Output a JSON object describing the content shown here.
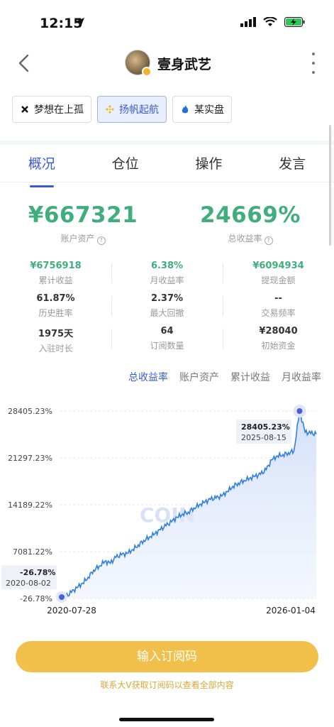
{
  "status": {
    "time": "12:15"
  },
  "nav": {
    "title": "壹身武艺"
  },
  "chips": [
    {
      "label": "梦想在上孤",
      "icon": "cross-logo-icon",
      "active": false
    },
    {
      "label": "扬帆起航",
      "icon": "binance-logo-icon",
      "active": true
    },
    {
      "label": "某实盘",
      "icon": "flame-logo-icon",
      "active": false
    }
  ],
  "tabs": [
    "概况",
    "仓位",
    "操作",
    "发言"
  ],
  "summary": {
    "assets_value": "¥667321",
    "assets_label": "账户资产",
    "return_value": "24669%",
    "return_label": "总收益率"
  },
  "grid": [
    [
      {
        "value": "¥6756918",
        "label": "累计收益",
        "green": true
      },
      {
        "value": "6.38%",
        "label": "月收益率",
        "green": true
      },
      {
        "value": "¥6094934",
        "label": "提现金额",
        "green": true
      }
    ],
    [
      {
        "value": "61.87%",
        "label": "历史胜率",
        "green": false
      },
      {
        "value": "2.37%",
        "label": "最大回撤",
        "green": false
      },
      {
        "value": "--",
        "label": "交易频率",
        "green": false
      }
    ],
    [
      {
        "value": "1975天",
        "label": "入驻时长",
        "green": false
      },
      {
        "value": "64",
        "label": "订阅数量",
        "green": false
      },
      {
        "value": "¥28040",
        "label": "初始资金",
        "green": false
      }
    ]
  ],
  "chart_tabs": [
    "总收益率",
    "账户资产",
    "累计收益",
    "月收益率"
  ],
  "chart_data": {
    "type": "area",
    "y_ticks": [
      "28405.23%",
      "21297.23%",
      "14189.22%",
      "7081.22%",
      "-26.78%"
    ],
    "ylim": [
      -26.78,
      28405.23
    ],
    "x_labels": [
      "2020-07-28",
      "2026-01-04"
    ],
    "watermark": "COIN",
    "color": "#2f7fe0",
    "min_marker": {
      "value": "-26.78%",
      "date": "2020-08-02"
    },
    "max_marker": {
      "value": "28405.23%",
      "date": "2025-08-15"
    },
    "series": [
      {
        "values": [
          -26.78,
          200,
          900,
          1600,
          2300,
          3200,
          4300,
          4900,
          5600,
          5300,
          6200,
          6600,
          6800,
          7400,
          8100,
          8800,
          9300,
          9800,
          10400,
          11000,
          11600,
          12300,
          12800,
          13100,
          13700,
          14200,
          14600,
          15000,
          15200,
          15500,
          16200,
          17000,
          17500,
          17900,
          18200,
          18500,
          18800,
          19500,
          21000,
          21600,
          21800,
          22100,
          22400,
          28405.23,
          25200,
          25000,
          24900
        ]
      }
    ]
  },
  "cta": {
    "label": "输入订阅码",
    "hint": "联系大V获取订阅码以查看全部内容"
  }
}
